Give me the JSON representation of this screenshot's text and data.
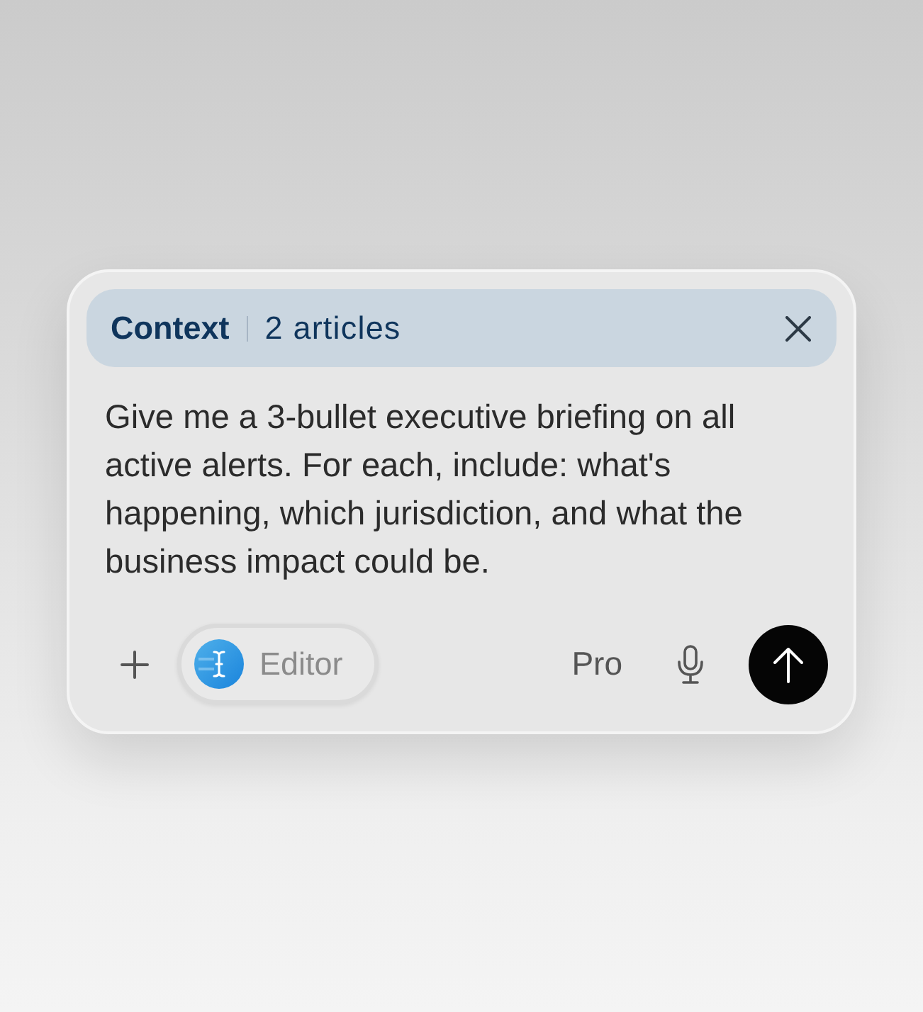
{
  "context": {
    "label": "Context",
    "count": "2 articles"
  },
  "prompt": {
    "text": "Give me a 3-bullet executive briefing on all active alerts. For each, include: what's happening, which jurisdiction, and what the business impact could be."
  },
  "toolbar": {
    "mode": {
      "label": "Editor"
    },
    "model": "Pro"
  }
}
